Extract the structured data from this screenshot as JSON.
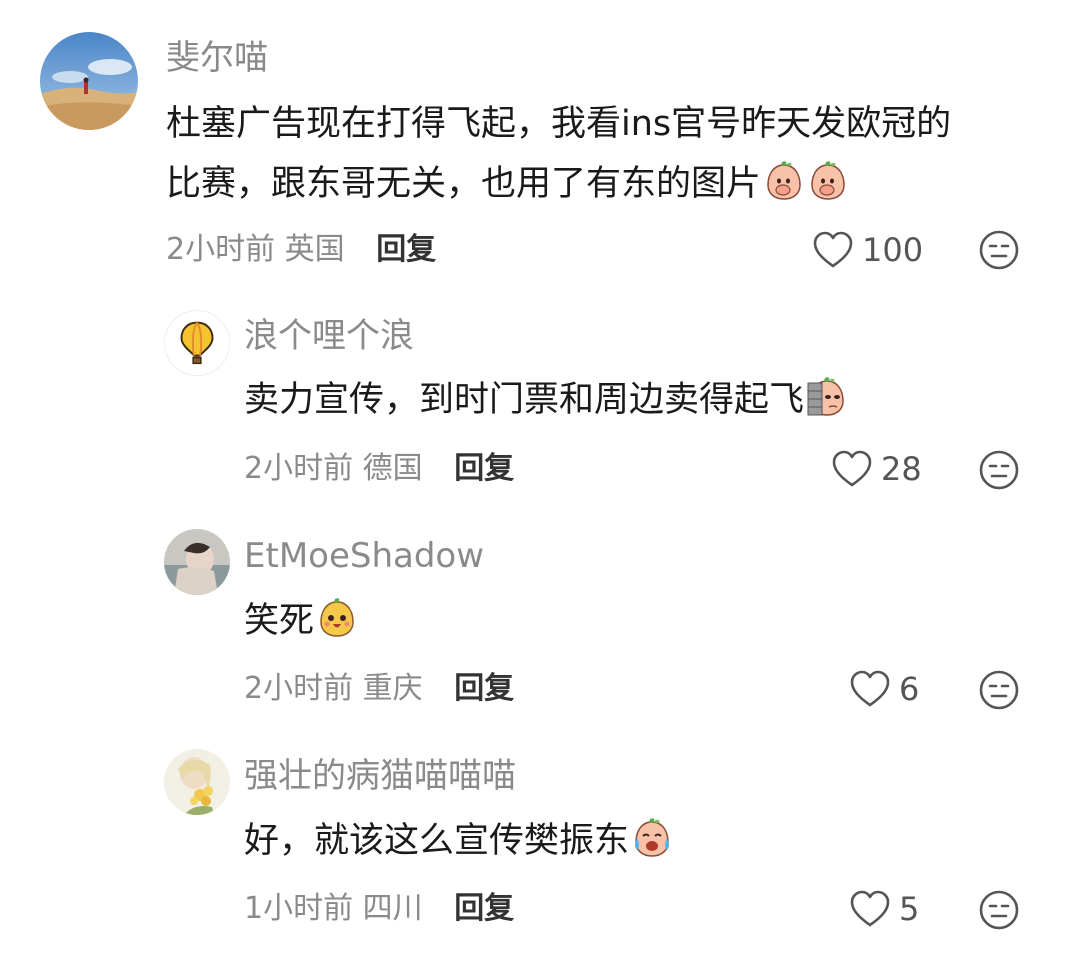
{
  "comments": [
    {
      "name": "斐尔喵",
      "text_line1": "杜塞广告现在打得飞起，我看ins官号昨天发欧冠的",
      "text_line2": "比赛，跟东哥无关，也用了有东的图片",
      "emojis": [
        "covering-mouth-emoji",
        "covering-mouth-emoji"
      ],
      "time": "2小时前",
      "location": "英国",
      "reply_label": "回复",
      "likes": "100",
      "avatar": "desert-landscape-avatar"
    },
    {
      "name": "浪个哩个浪",
      "text": "卖力宣传，到时门票和周边卖得起飞",
      "emojis": [
        "peeking-wall-emoji"
      ],
      "time": "2小时前",
      "location": "德国",
      "reply_label": "回复",
      "likes": "28",
      "avatar": "hot-air-balloon-avatar"
    },
    {
      "name": "EtMoeShadow",
      "text": "笑死",
      "emojis": [
        "laughing-emoji"
      ],
      "time": "2小时前",
      "location": "重庆",
      "reply_label": "回复",
      "likes": "6",
      "avatar": "person-photo-avatar"
    },
    {
      "name": "强壮的病猫喵喵喵",
      "text": "好，就该这么宣传樊振东",
      "emojis": [
        "crying-laughing-emoji"
      ],
      "time": "1小时前",
      "location": "四川",
      "reply_label": "回复",
      "likes": "5",
      "avatar": "flowers-avatar"
    }
  ],
  "colors": {
    "name": "#8a8a8a",
    "text": "#1a1a1a",
    "meta": "#8a8a8a",
    "reply": "#333333"
  }
}
